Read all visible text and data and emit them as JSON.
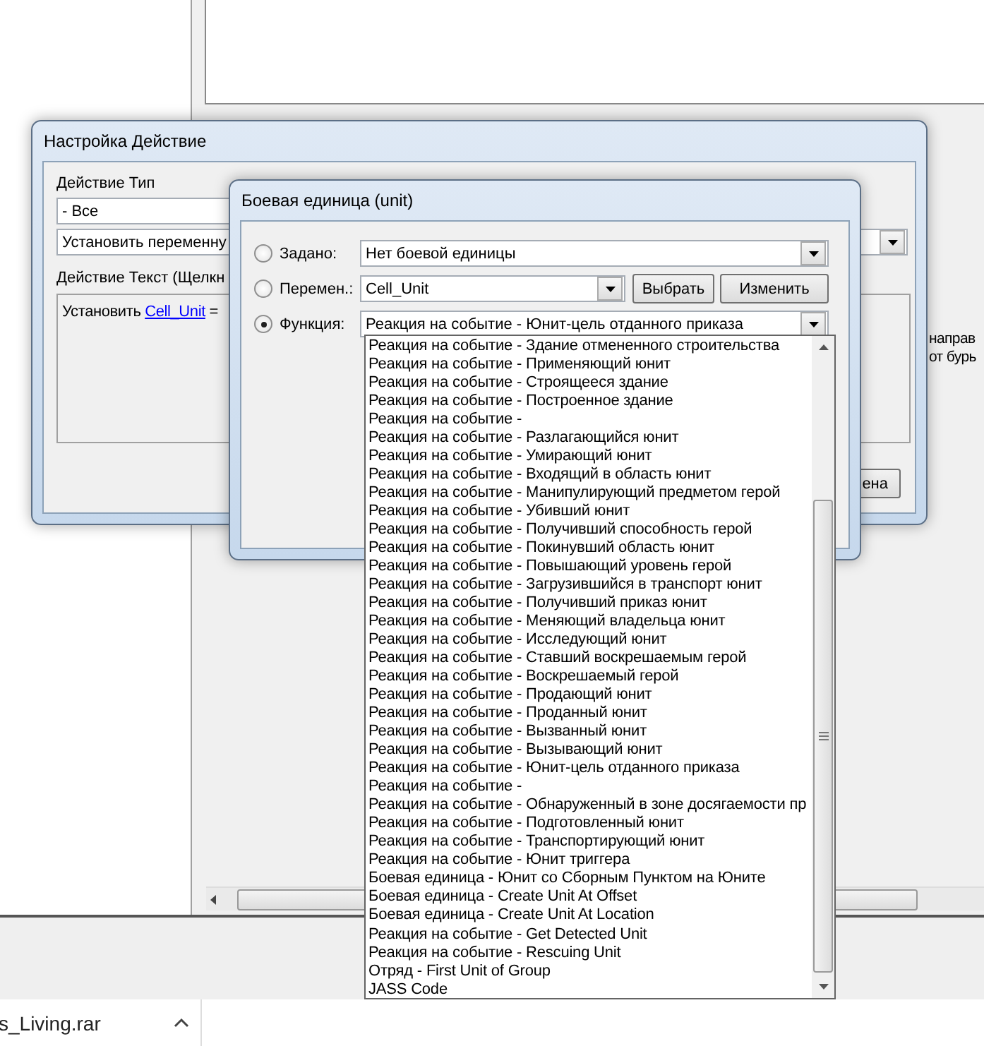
{
  "action_dialog": {
    "title": "Настройка Действие",
    "type_label": "Действие Тип",
    "category_value": "- Все",
    "action_value": "Установить переменну",
    "text_label": "Действие Текст (Щелкн",
    "action_text": {
      "prefix": "Установить",
      "link": "Cell_Unit",
      "suffix": "="
    },
    "side_texts": [
      "направ",
      "от бурь"
    ],
    "cancel_button": "ена"
  },
  "unit_dialog": {
    "title": "Боевая единица (unit)",
    "options": [
      {
        "label": "Задано:",
        "selected": false,
        "kind": "combo",
        "value": "Нет боевой единицы"
      },
      {
        "label": "Перемен.:",
        "selected": false,
        "kind": "combo_buttons",
        "value": "Cell_Unit",
        "buttons": [
          "Выбрать",
          "Изменить"
        ]
      },
      {
        "label": "Функция:",
        "selected": true,
        "kind": "combo",
        "value": "Реакция на событие - Юнит-цель отданного приказа"
      }
    ],
    "dropdown_items": [
      "Реакция на событие - Здание отмененного строительства",
      "Реакция на событие - Применяющий юнит",
      "Реакция на событие - Строящееся здание",
      "Реакция на событие - Построенное здание",
      "Реакция на событие -",
      "Реакция на событие - Разлагающийся юнит",
      "Реакция на событие - Умирающий юнит",
      "Реакция на событие - Входящий в область юнит",
      "Реакция на событие - Манипулирующий предметом герой",
      "Реакция на событие - Убивший юнит",
      "Реакция на событие - Получивший способность герой",
      "Реакция на событие - Покинувший область юнит",
      "Реакция на событие - Повышающий уровень герой",
      "Реакция на событие - Загрузившийся в транспорт юнит",
      "Реакция на событие - Получивший приказ юнит",
      "Реакция на событие - Меняющий владельца юнит",
      "Реакция на событие - Исследующий юнит",
      "Реакция на событие - Ставший воскрешаемым герой",
      "Реакция на событие - Воскрешаемый герой",
      "Реакция на событие - Продающий юнит",
      "Реакция на событие - Проданный юнит",
      "Реакция на событие - Вызванный юнит",
      "Реакция на событие - Вызывающий юнит",
      "Реакция на событие - Юнит-цель отданного приказа",
      "Реакция на событие -",
      "Реакция на событие - Обнаруженный в зоне досягаемости пр",
      "Реакция на событие - Подготовленный юнит",
      "Реакция на событие - Транспортирующий юнит",
      "Реакция на событие - Юнит триггера",
      "Боевая единица - Юнит со Сборным Пунктом на Юните",
      "Боевая единица - Create Unit At Offset",
      "Боевая единица - Create Unit At Location",
      "Реакция на событие - Get Detected Unit",
      "Реакция на событие - Rescuing Unit",
      "Отряд - First Unit of Group",
      "JASS Code"
    ]
  },
  "taskbar": {
    "download_file": "s_Living.rar"
  }
}
